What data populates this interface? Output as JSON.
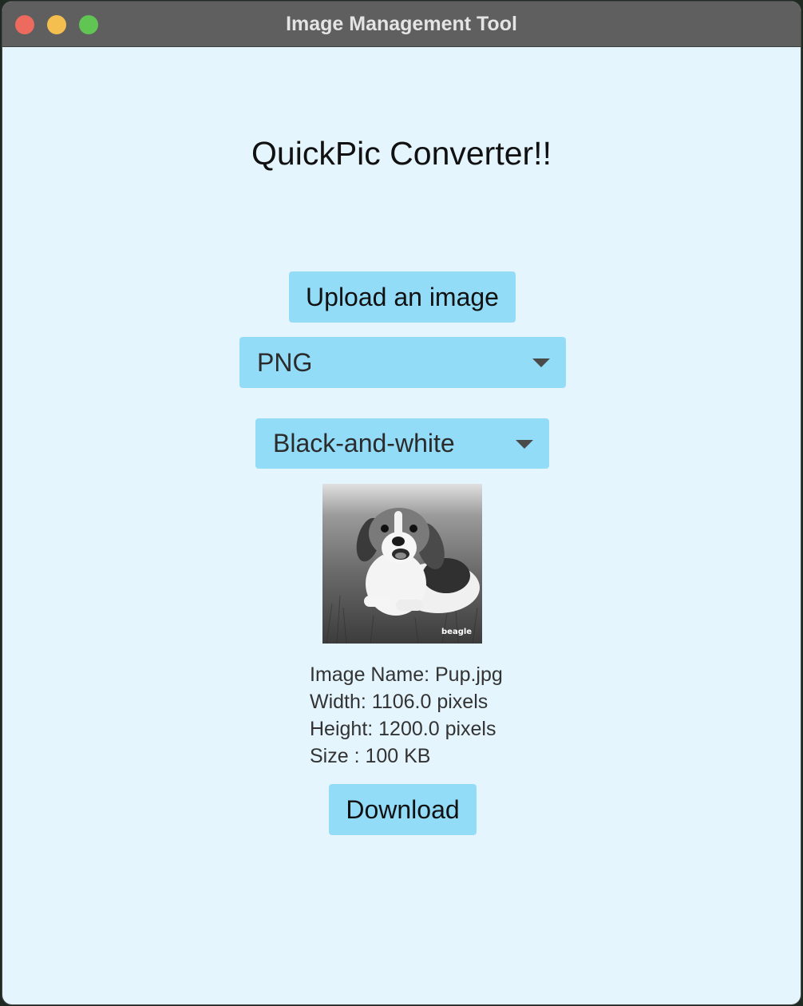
{
  "window": {
    "title": "Image Management Tool"
  },
  "main": {
    "heading": "QuickPic Converter!!",
    "upload_label": "Upload an image",
    "format_selected": "PNG",
    "filter_selected": "Black-and-white",
    "preview_watermark": "beagle",
    "info": {
      "name": "Image Name: Pup.jpg",
      "width": "Width: 1106.0 pixels",
      "height": "Height: 1200.0 pixels",
      "size": "Size : 100 KB"
    },
    "download_label": "Download"
  },
  "colors": {
    "background": "#e4f5fd",
    "button": "#93dcf8",
    "titlebar": "#5f5f5f"
  },
  "icons": {
    "close": "close-icon",
    "minimize": "minimize-icon",
    "maximize": "maximize-icon",
    "dropdown": "chevron-down-icon"
  }
}
